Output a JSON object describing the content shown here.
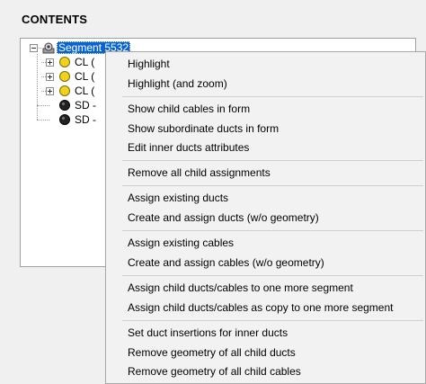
{
  "panel": {
    "title": "CONTENTS"
  },
  "tree": {
    "root": {
      "label": "Segment 5532"
    },
    "children": [
      {
        "label": "CL (",
        "icon": "yellow-circle-icon"
      },
      {
        "label": "CL (",
        "icon": "yellow-circle-icon"
      },
      {
        "label": "CL (",
        "icon": "yellow-circle-icon"
      },
      {
        "label": "SD -",
        "icon": "black-circle-icon"
      },
      {
        "label": "SD -",
        "icon": "black-circle-icon"
      }
    ]
  },
  "context_menu": {
    "items": [
      "Highlight",
      "Highlight (and zoom)",
      "Show child cables in form",
      "Show subordinate ducts in form",
      "Edit inner ducts attributes",
      "Remove all child assignments",
      "Assign existing ducts",
      "Create and assign ducts (w/o geometry)",
      "Assign existing cables",
      "Create and assign cables (w/o geometry)",
      "Assign child ducts/cables to one more segment",
      "Assign child ducts/cables as copy to one more segment",
      "Set duct insertions for inner ducts",
      "Remove geometry of all child ducts",
      "Remove geometry of all child cables"
    ]
  },
  "colors": {
    "selection": "#0a64d0",
    "menu_bg": "#f2f2f2",
    "yellow_node": "#f2d21a",
    "black_node": "#222222"
  }
}
